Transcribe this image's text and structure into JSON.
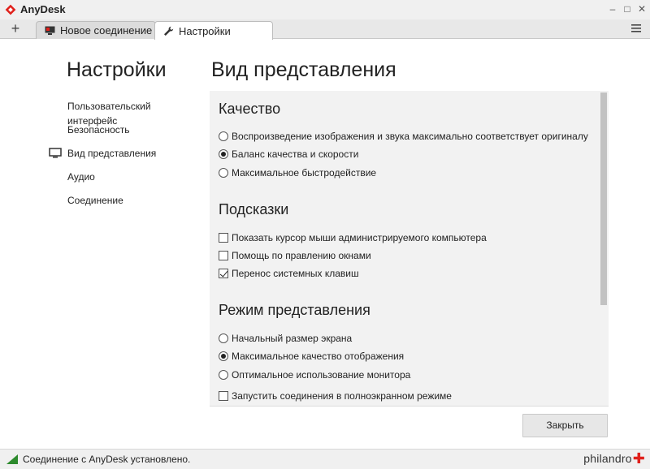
{
  "window": {
    "title": "AnyDesk",
    "controls": {
      "minimize": "–",
      "maximize": "□",
      "close": "✕"
    }
  },
  "tabs": {
    "add_label": "+",
    "items": [
      {
        "label": "Новое соединение",
        "icon": "monitor-icon",
        "active": false
      },
      {
        "label": "Настройки",
        "icon": "wrench-icon",
        "active": true
      }
    ]
  },
  "page": {
    "settings_title": "Настройки",
    "section_title": "Вид представления"
  },
  "nav": {
    "items": [
      {
        "label": "Пользовательский интерфейс"
      },
      {
        "label": "Безопасность"
      },
      {
        "label": "Вид представления",
        "icon": "monitor-icon",
        "selected": true
      },
      {
        "label": "Аудио"
      },
      {
        "label": "Соединение"
      }
    ]
  },
  "groups": {
    "quality": {
      "title": "Качество",
      "options": [
        {
          "label": "Воспроизведение изображения и звука максимально соответствует оригиналу",
          "checked": false
        },
        {
          "label": "Баланс качества и скорости",
          "checked": true
        },
        {
          "label": "Максимальное быстродействие",
          "checked": false
        }
      ]
    },
    "hints": {
      "title": "Подсказки",
      "options": [
        {
          "label": "Показать курсор мыши администрируемого компьютера",
          "checked": false
        },
        {
          "label": "Помощь по правлению окнами",
          "checked": false
        },
        {
          "label": "Перенос системных клавиш",
          "checked": true
        }
      ]
    },
    "view_mode": {
      "title": "Режим представления",
      "options": [
        {
          "label": "Начальный размер экрана",
          "checked": false
        },
        {
          "label": "Максимальное качество отображения",
          "checked": true
        },
        {
          "label": "Оптимальное использование монитора",
          "checked": false
        }
      ],
      "fullscreen": {
        "label": "Запустить соединения в полноэкранном режиме",
        "checked": false
      }
    }
  },
  "buttons": {
    "close_label": "Закрыть"
  },
  "status": {
    "text": "Соединение с AnyDesk установлено.",
    "brand": "philandro"
  },
  "colors": {
    "brand_red": "#e0201b",
    "status_green": "#2e8b2e"
  }
}
